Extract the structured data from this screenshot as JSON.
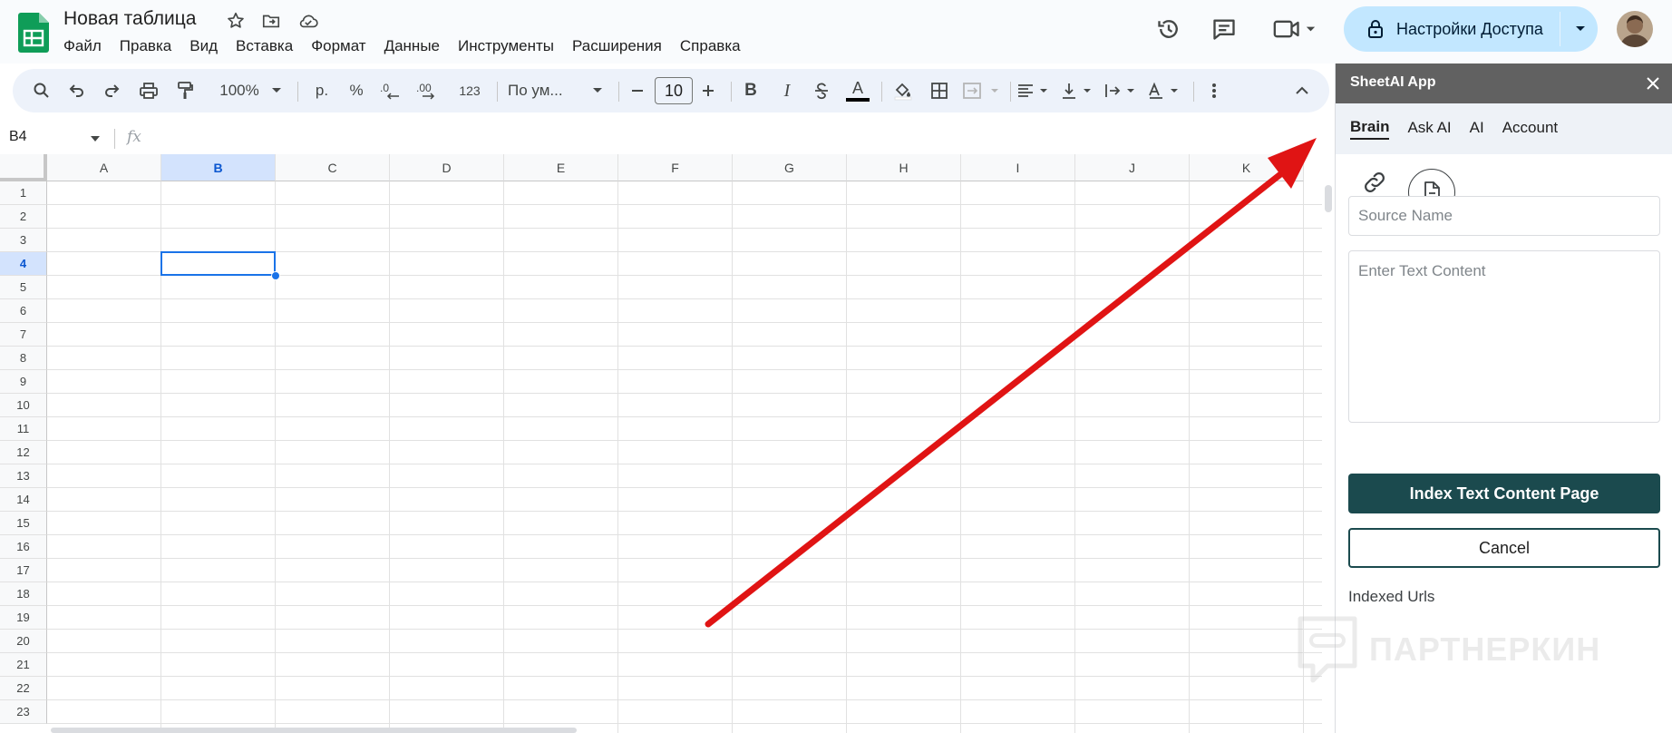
{
  "document": {
    "title": "Новая таблица"
  },
  "menu": [
    "Файл",
    "Правка",
    "Вид",
    "Вставка",
    "Формат",
    "Данные",
    "Инструменты",
    "Расширения",
    "Справка"
  ],
  "share": {
    "label": "Настройки Доступа"
  },
  "toolbar": {
    "zoom": "100%",
    "currency": "р.",
    "percent": "%",
    "decrease_decimals": ".0",
    "increase_decimals": ".00",
    "number_format": "123",
    "font_family": "По ум...",
    "font_size": "10",
    "bold": "B",
    "italic": "I",
    "text_color": "A"
  },
  "formula_bar": {
    "cell_ref": "B4",
    "fx": "fx"
  },
  "grid": {
    "columns": [
      "A",
      "B",
      "C",
      "D",
      "E",
      "F",
      "G",
      "H",
      "I",
      "J",
      "K"
    ],
    "rows": [
      "1",
      "2",
      "3",
      "4",
      "5",
      "6",
      "7",
      "8",
      "9",
      "10",
      "11",
      "12",
      "13",
      "14",
      "15",
      "16",
      "17",
      "18",
      "19",
      "20",
      "21",
      "22",
      "23"
    ],
    "selected_column": "B",
    "selected_row": "4"
  },
  "panel": {
    "title": "SheetAI App",
    "tabs": [
      "Brain",
      "Ask AI",
      "AI",
      "Account"
    ],
    "active_tab": "Brain",
    "source_name_placeholder": "Source Name",
    "text_content_placeholder": "Enter Text Content",
    "index_button": "Index Text Content Page",
    "cancel_button": "Cancel",
    "indexed_urls_label": "Indexed Urls"
  },
  "watermark": {
    "text": "ПАРТНЕРКИН"
  },
  "colors": {
    "accent_blue": "#1a73e8",
    "share_bg": "#c2e7ff",
    "toolbar_bg": "#edf2fa",
    "panel_header": "#616161",
    "primary_button": "#1b4a4e",
    "annotation_arrow": "#e01414"
  }
}
